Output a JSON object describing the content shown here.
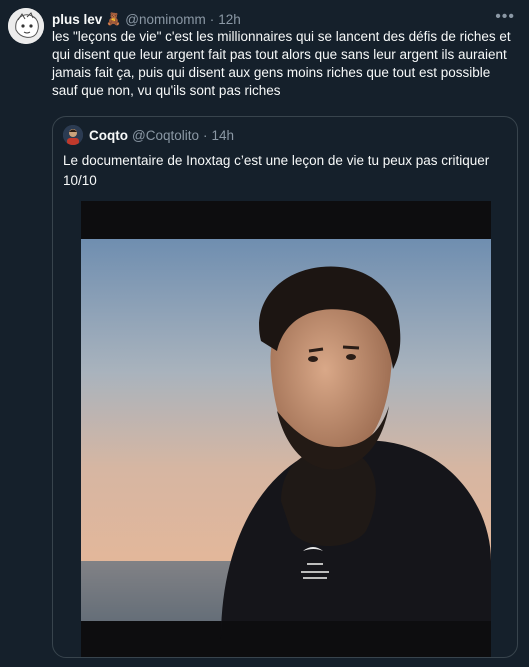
{
  "tweet": {
    "display_name": "plus lev",
    "badge_emoji": "🧸",
    "handle": "@nominomm",
    "separator": "·",
    "time": "12h",
    "more_icon": "more-horizontal-icon",
    "text": "les \"leçons de vie\" c'est les millionnaires qui se lancent des défis de riches et qui disent que leur argent fait pas tout alors que sans leur argent ils auraient jamais fait ça, puis qui disent aux gens moins riches que tout est possible sauf que non, vu qu'ils sont pas riches"
  },
  "quote": {
    "display_name": "Coqto",
    "handle": "@Coqtolito",
    "separator": "·",
    "time": "14h",
    "text_line1": "Le documentaire de Inoxtag c’est une leçon de vie tu peux pas critiquer",
    "text_line2": "10/10"
  },
  "colors": {
    "background": "#15202b",
    "primary_text": "#f7f9f9",
    "secondary_text": "#8b98a5",
    "border": "#38444d"
  }
}
